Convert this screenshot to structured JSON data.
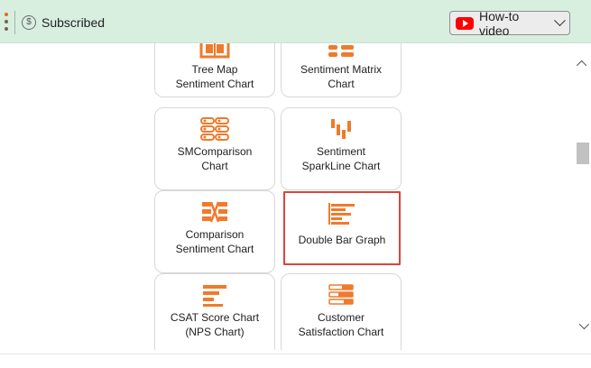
{
  "header": {
    "subscribed_label": "Subscribed",
    "howto_label": "How-to video",
    "colors": {
      "bar_bg": "#d8efe0",
      "kebab_dot_top": "#e8682a",
      "kebab_dot_mid": "#7b5f55",
      "kebab_dot_bottom": "#7b5f55",
      "youtube_red": "#ff0000"
    },
    "icons": [
      "kebab-menu-icon",
      "dollar-circle-icon",
      "youtube-icon",
      "chevron-down-icon"
    ]
  },
  "accent_color": "#f07a2c",
  "selected_border_color": "#d9463b",
  "cards": [
    {
      "label": "Tree Map\nSentiment Chart",
      "icon": "tree-map-icon",
      "selected": false
    },
    {
      "label": "Sentiment Matrix\nChart",
      "icon": "sentiment-matrix-icon",
      "selected": false
    },
    {
      "label": "SMComparison\nChart",
      "icon": "smcomparison-icon",
      "selected": false
    },
    {
      "label": "Sentiment\nSparkLine Chart",
      "icon": "sparkline-icon",
      "selected": false
    },
    {
      "label": "Comparison\nSentiment Chart",
      "icon": "comparison-sentiment-icon",
      "selected": false
    },
    {
      "label": "Double Bar Graph",
      "icon": "double-bar-graph-icon",
      "selected": true
    },
    {
      "label": "CSAT Score Chart\n(NPS Chart)",
      "icon": "csat-score-icon",
      "selected": false
    },
    {
      "label": "Customer\nSatisfaction Chart",
      "icon": "customer-satisfaction-icon",
      "selected": false
    }
  ],
  "scrollbar": {
    "icons": [
      "scroll-up-icon",
      "scroll-down-icon"
    ]
  }
}
